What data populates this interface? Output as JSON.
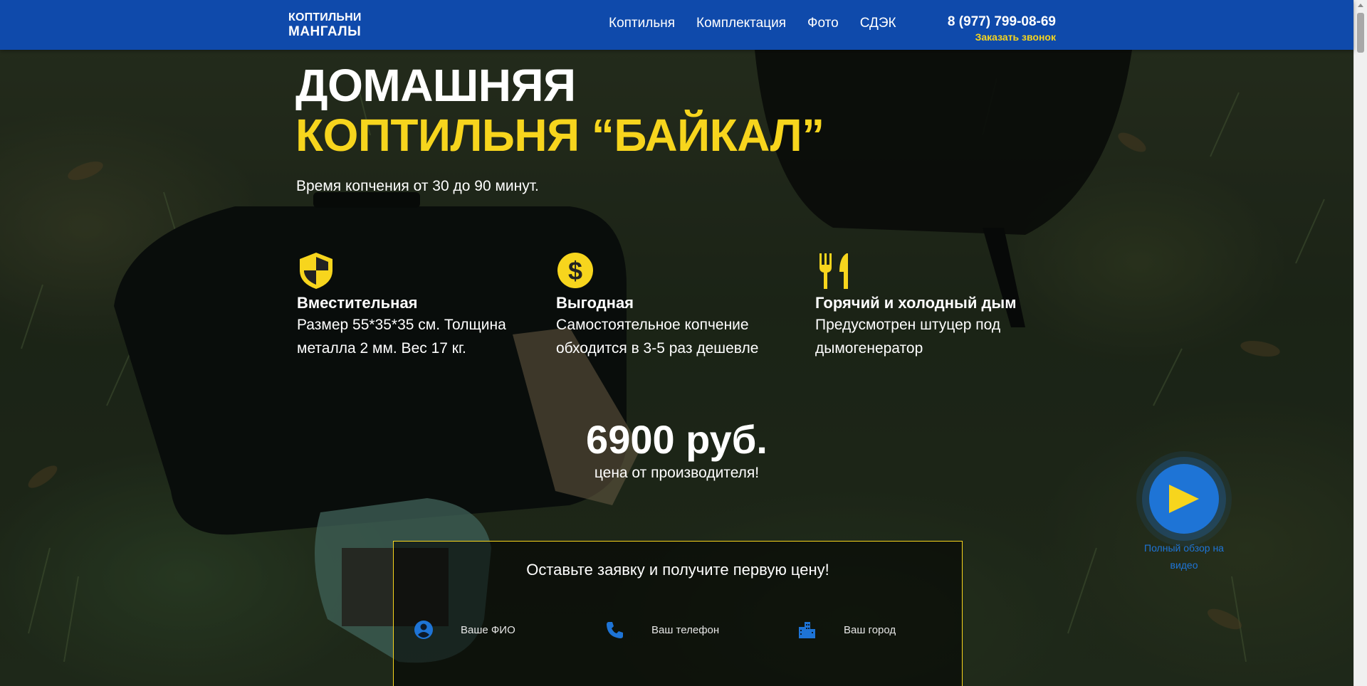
{
  "header": {
    "logo_line1": "коптильни",
    "logo_line2": "мангалы",
    "nav": [
      "Коптильня",
      "Комплектация",
      "Фото",
      "СДЭК"
    ],
    "phone": "8 (977) 799-08-69",
    "callback": "Заказать звонок"
  },
  "hero": {
    "title_line1": "Домашняя",
    "title_line2": "коптильня “Байкал”",
    "subtitle": "Время копчения от 30 до 90 минут.",
    "features": [
      {
        "icon": "shield-icon",
        "title": "Вместительная",
        "text": "Размер 55*35*35 см. Толщина металла 2 мм. Вес 17 кг."
      },
      {
        "icon": "dollar-coin-icon",
        "title": "Выгодная",
        "text": "Самостоятельное копчение обходится в 3-5 раз дешевле"
      },
      {
        "icon": "fork-knife-icon",
        "title": "Горячий и холодный дым",
        "text": "Предусмотрен штуцер под дымогенератор"
      }
    ],
    "price": "6900 руб.",
    "price_note": "цена от производителя!",
    "video_label": "Полный обзор на видео"
  },
  "form": {
    "title": "Оставьте заявку и получите первую цену!",
    "fields": [
      {
        "icon": "person-icon",
        "label": "Ваше ФИО"
      },
      {
        "icon": "phone-icon",
        "label": "Ваш телефон"
      },
      {
        "icon": "city-icon",
        "label": "Ваш город"
      }
    ]
  },
  "colors": {
    "header_bg": "#0f4aab",
    "accent_yellow": "#f7d51d",
    "video_blue": "#1e74d6"
  }
}
